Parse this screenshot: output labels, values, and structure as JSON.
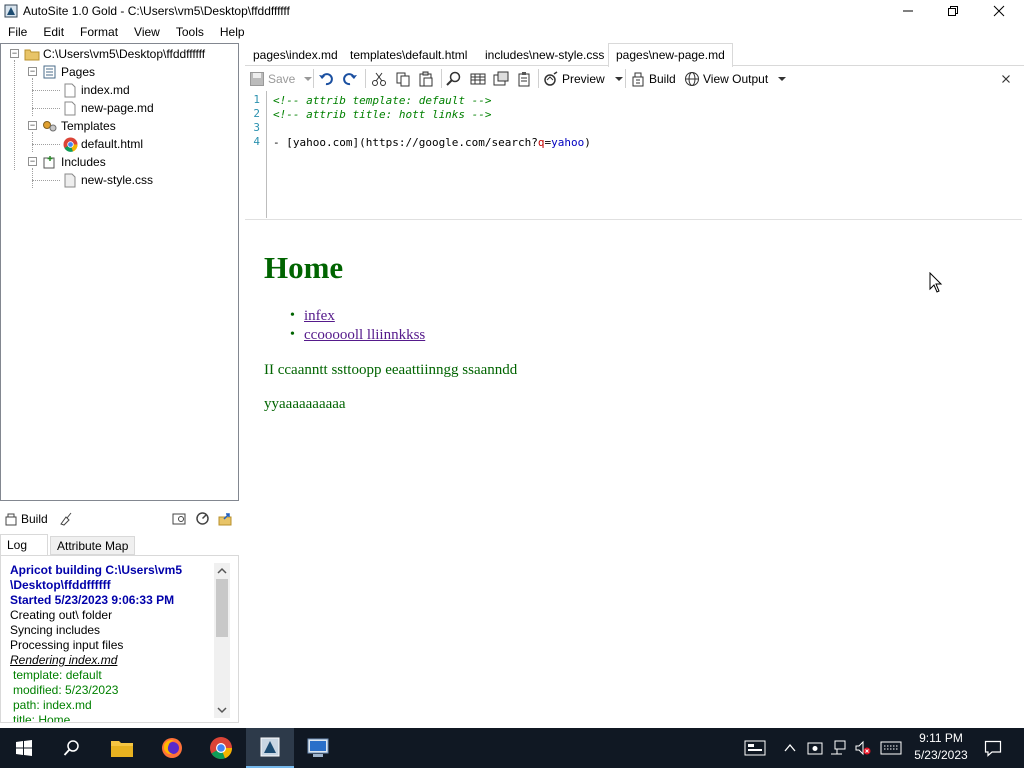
{
  "window": {
    "title": "AutoSite 1.0 Gold - C:\\Users\\vm5\\Desktop\\ffddffffff"
  },
  "menu": [
    "File",
    "Edit",
    "Format",
    "View",
    "Tools",
    "Help"
  ],
  "tree": {
    "root": "C:\\Users\\vm5\\Desktop\\ffddffffff",
    "pages_label": "Pages",
    "pages": [
      "index.md",
      "new-page.md"
    ],
    "templates_label": "Templates",
    "templates": [
      "default.html"
    ],
    "includes_label": "Includes",
    "includes": [
      "new-style.css"
    ]
  },
  "build_panel": {
    "build_label": "Build"
  },
  "log_tabs": [
    "Log",
    "Attribute Map"
  ],
  "log": {
    "lines": [
      {
        "text": "Apricot building C:\\Users\\vm5",
        "style": "heading"
      },
      {
        "text": "\\Desktop\\ffddffffff",
        "style": "heading"
      },
      {
        "text": "Started 5/23/2023 9:06:33 PM",
        "style": "heading"
      },
      {
        "text": "Creating out\\ folder",
        "style": "normal"
      },
      {
        "text": "Syncing includes",
        "style": "normal"
      },
      {
        "text": "Processing input files",
        "style": "normal"
      },
      {
        "text": "Rendering index.md",
        "style": "italic"
      },
      {
        "text": " template: default",
        "style": "green"
      },
      {
        "text": " modified: 5/23/2023",
        "style": "green"
      },
      {
        "text": " path: index.md",
        "style": "green"
      },
      {
        "text": " title: Home",
        "style": "green"
      }
    ]
  },
  "tabs": [
    "pages\\index.md",
    "templates\\default.html",
    "includes\\new-style.css",
    "pages\\new-page.md"
  ],
  "active_tab": "pages\\new-page.md",
  "toolbar": {
    "save": "Save",
    "preview": "Preview",
    "build": "Build",
    "view_output": "View Output"
  },
  "editor": {
    "line_numbers": [
      "1",
      "2",
      "3",
      "4"
    ],
    "line1": "<!-- attrib template: default -->",
    "line2": "<!-- attrib title: hott links -->",
    "line4_a": "- [yahoo.com](https://google.com/search?",
    "line4_q": "q",
    "line4_eq": "=",
    "line4_v": "yahoo",
    "line4_end": ")"
  },
  "preview": {
    "heading": "Home",
    "links": [
      "infex",
      "ccoooooll lliinnkkss"
    ],
    "para1": "II ccaanntt ssttoopp eeaattiinngg ssaanndd",
    "para2": "yyaaaaaaaaaa"
  },
  "taskbar": {
    "time": "9:11 PM",
    "date": "5/23/2023"
  },
  "colors": {
    "heading_green": "#006400",
    "link_purple": "#551a8b",
    "log_blue": "#0000aa",
    "log_green": "#008000",
    "taskbar": "#101823"
  }
}
